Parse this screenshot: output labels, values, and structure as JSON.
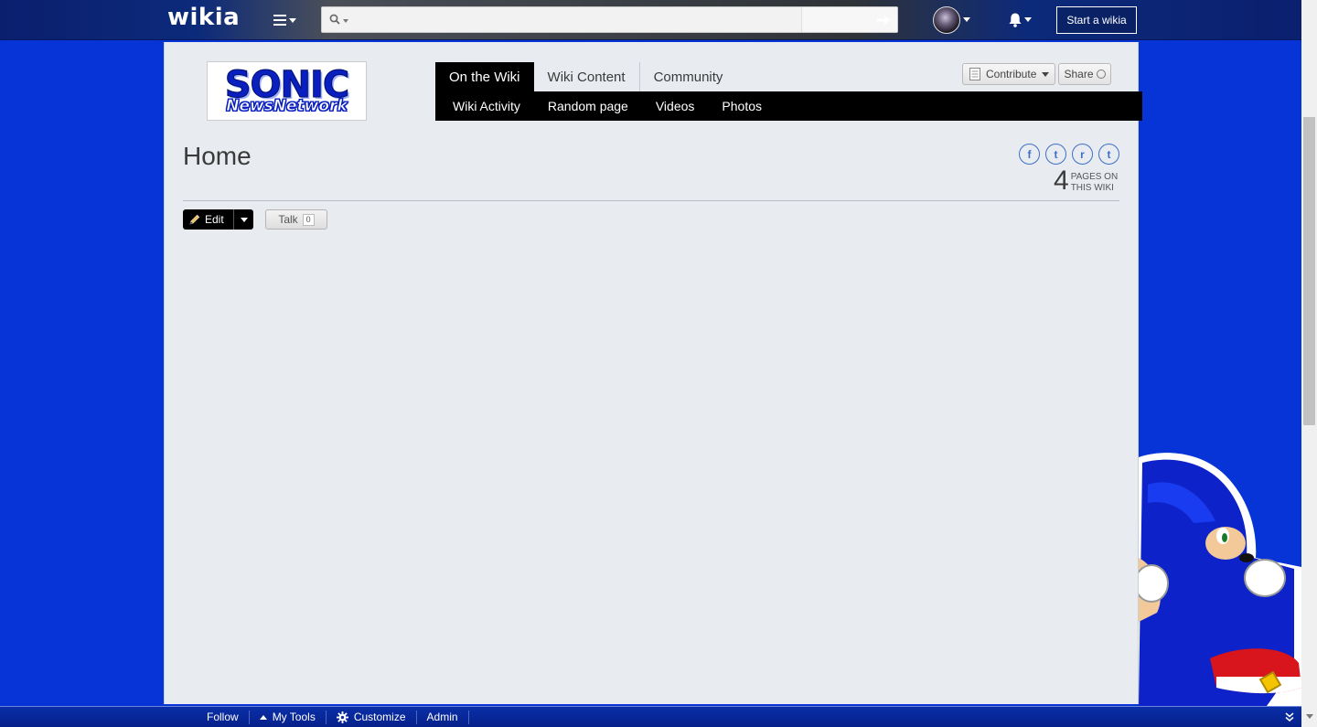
{
  "global_nav": {
    "logo": "wikia",
    "search": {
      "value": "",
      "placeholder": "",
      "submit_icon": "arrow-right-icon"
    },
    "start_wikia_label": "Start a wikia"
  },
  "wiki": {
    "wordmark": {
      "line1": "SONIC",
      "line2": "NewsNetwork"
    },
    "tabs": [
      {
        "label": "On the Wiki",
        "active": true
      },
      {
        "label": "Wiki Content",
        "active": false
      },
      {
        "label": "Community",
        "active": false
      }
    ],
    "subnav": [
      "Wiki Activity",
      "Random page",
      "Videos",
      "Photos"
    ],
    "contribute_label": "Contribute",
    "share_label": "Share"
  },
  "page": {
    "title": "Home",
    "social": [
      "f",
      "t",
      "r",
      "t"
    ],
    "page_count": {
      "number": "4",
      "label_line1": "PAGES ON",
      "label_line2": "THIS WIKI"
    },
    "edit_label": "Edit",
    "talk_label": "Talk",
    "talk_count": "0"
  },
  "toolbar": {
    "follow": "Follow",
    "my_tools": "My Tools",
    "customize": "Customize",
    "admin": "Admin"
  },
  "colors": {
    "page_background": "#0634d6",
    "content_background": "#e8ecf1",
    "tab_active": "#000000",
    "toolbar": "#0a2fa8"
  }
}
